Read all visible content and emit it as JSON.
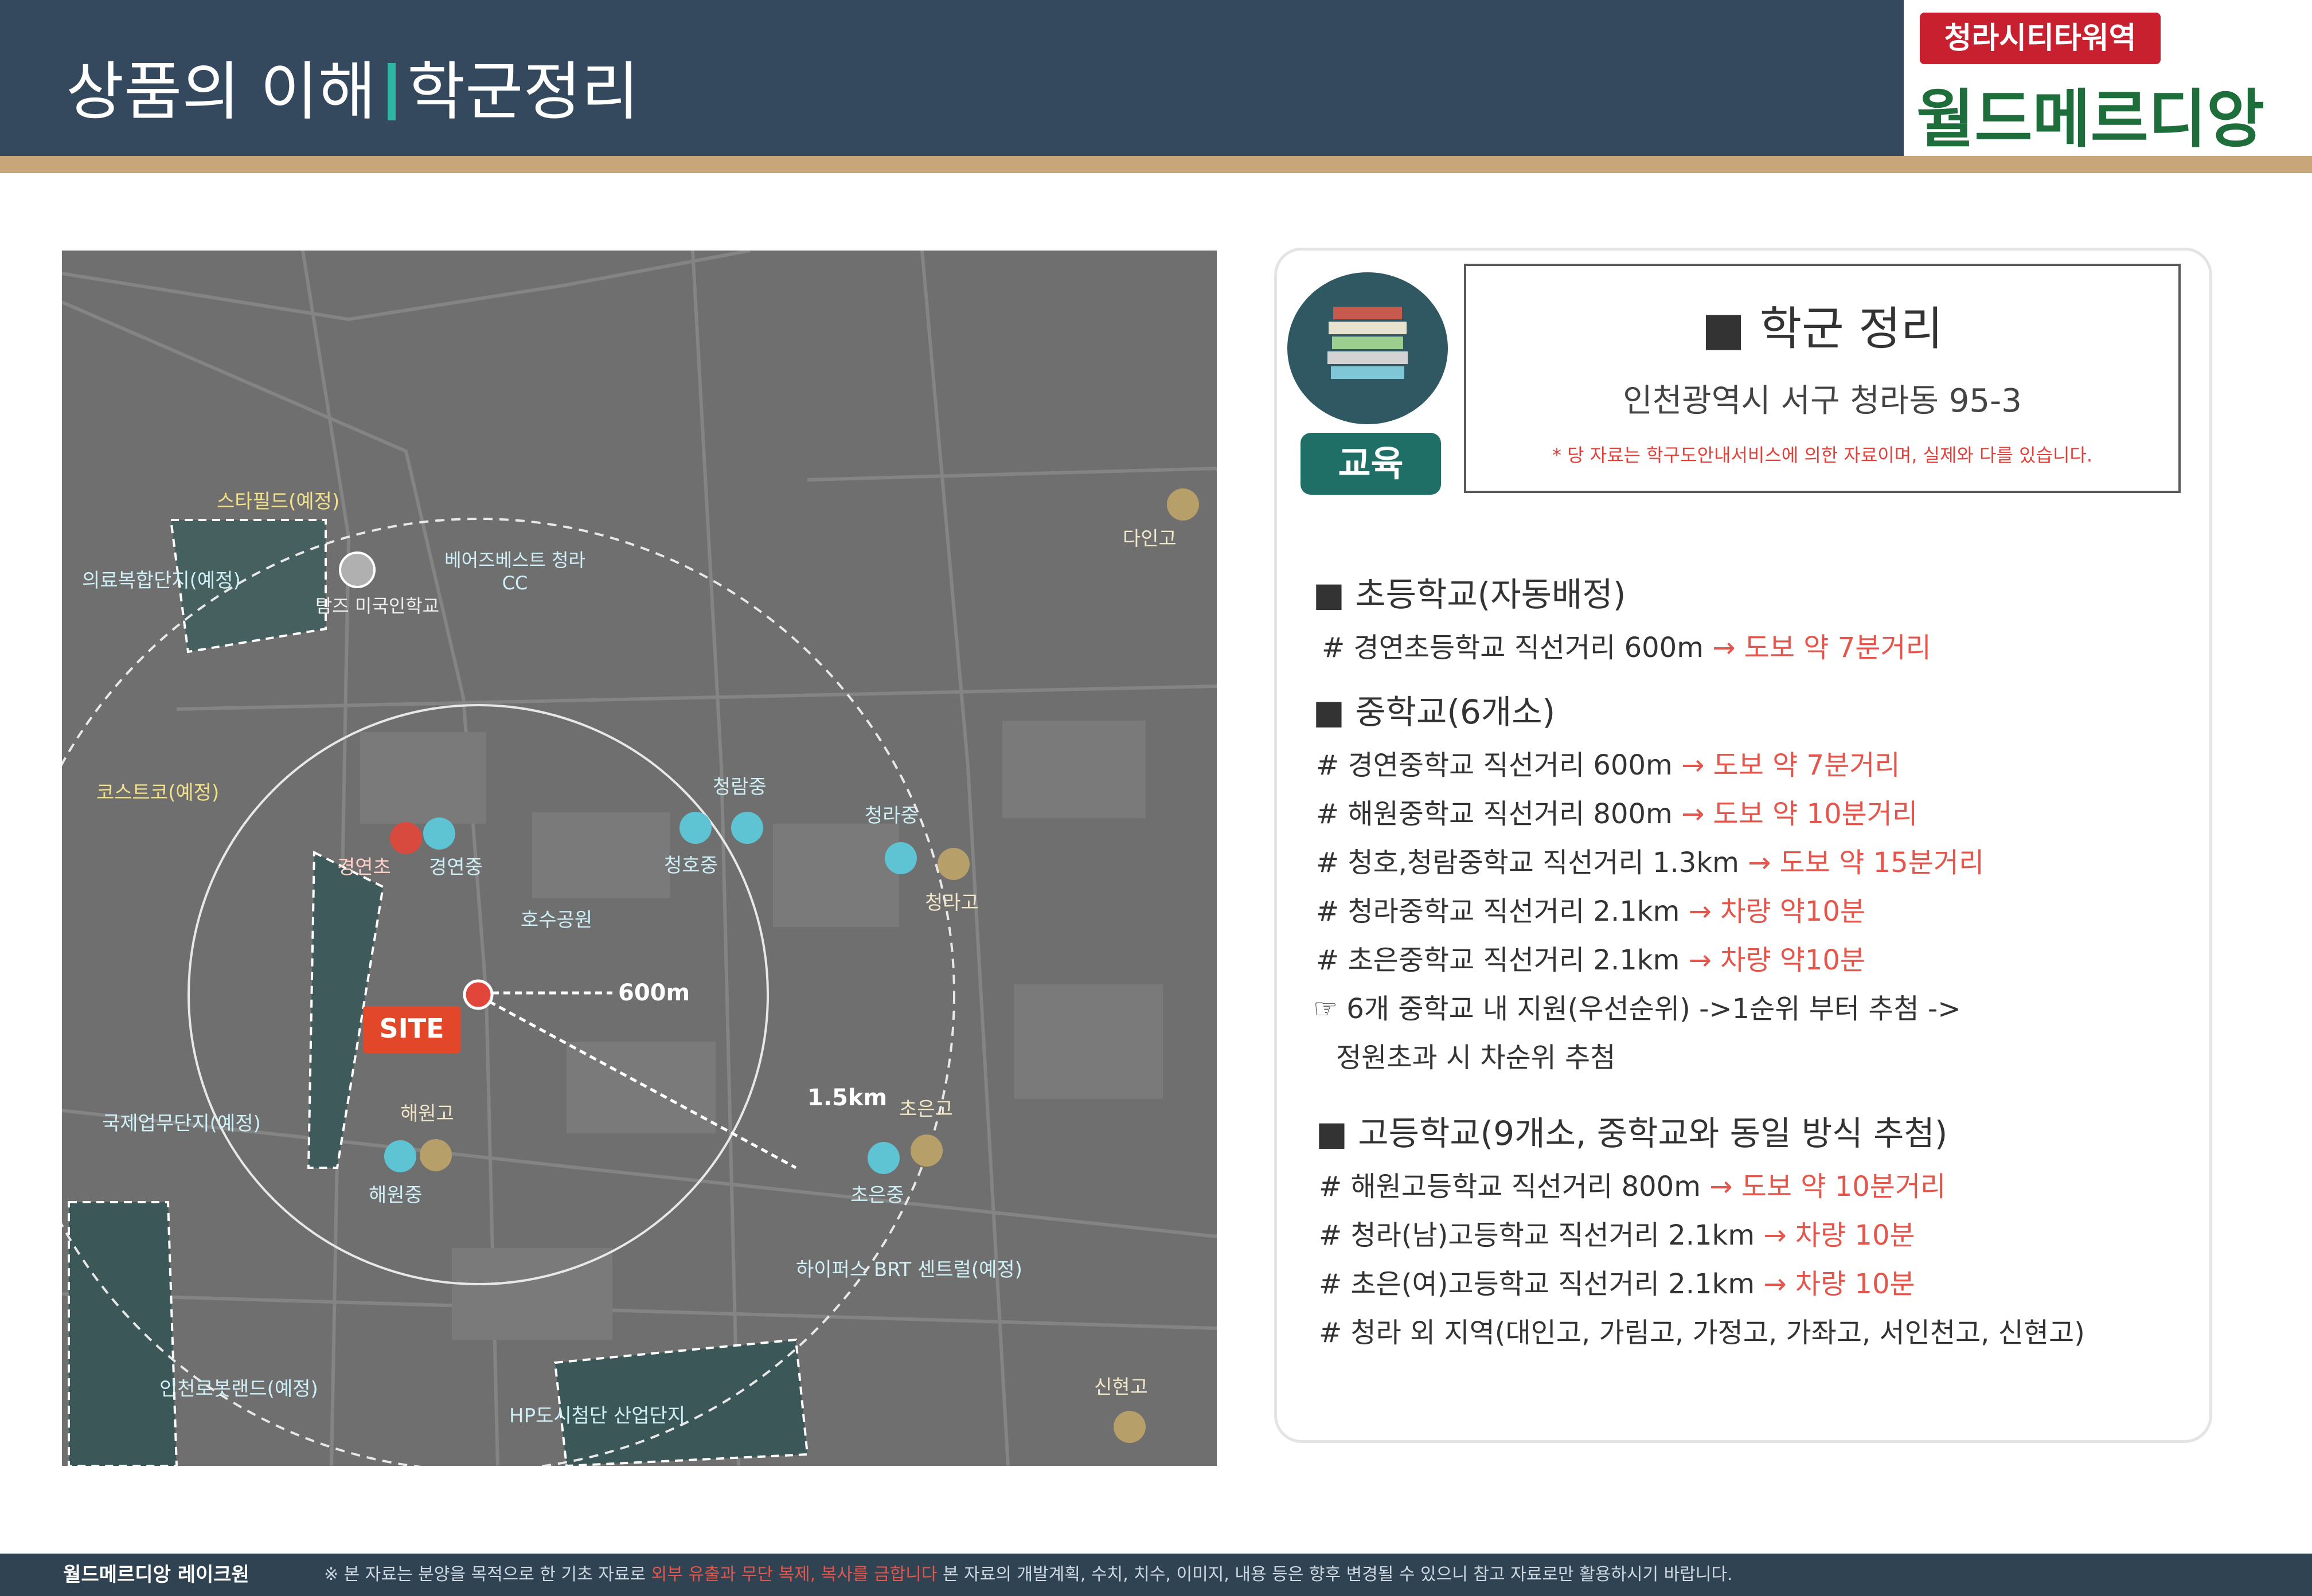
{
  "header": {
    "title_left": "상품의 이해",
    "title_right": "학군정리"
  },
  "logo": {
    "sub": "청라시티타워역",
    "main": "월드메르디앙"
  },
  "map": {
    "site_label": "SITE",
    "dist_600": "600m",
    "dist_1500": "1.5km",
    "places": [
      "스타필드(예정)",
      "의료복합단지(예정)",
      "탐즈 미국인학교",
      "베어즈베스트 청라CC",
      "다인고",
      "코스트코(예정)",
      "청람중",
      "청호중",
      "경연초",
      "경연중",
      "호수공원",
      "청라중",
      "청라고",
      "국제업무단지(예정)",
      "해원고",
      "해원중",
      "초은고",
      "초은중",
      "하이퍼스 BRT 센트럴(예정)",
      "인천로봇랜드(예정)",
      "HP도시첨단 산업단지",
      "신현고"
    ]
  },
  "panel": {
    "edu_label": "교육",
    "title": "■ 학군 정리",
    "address": "인천광역시 서구 청라동 95-3",
    "note": "* 당 자료는 학구도안내서비스에 의한 자료이며, 실제와 다를 있습니다.",
    "sec_elem": "■ 초등학교(자동배정)",
    "elem": [
      {
        "t": "# 경연초등학교 직선거리 600m",
        "r": "→ 도보 약 7분거리"
      }
    ],
    "sec_mid": "■ 중학교(6개소)",
    "mid": [
      {
        "t": "# 경연중학교 직선거리 600m",
        "r": "→ 도보 약 7분거리"
      },
      {
        "t": "# 해원중학교 직선거리 800m",
        "r": "→ 도보 약 10분거리"
      },
      {
        "t": "# 청호,청람중학교 직선거리 1.3km",
        "r": "→ 도보 약 15분거리"
      },
      {
        "t": "# 청라중학교 직선거리 2.1km",
        "r": "→ 차량 약10분"
      },
      {
        "t": "# 초은중학교 직선거리 2.1km",
        "r": "→ 차량 약10분"
      }
    ],
    "mid_note1": "☞ 6개 중학교 내 지원(우선순위) ->1순위 부터 추첨 ->",
    "mid_note2": "정원초과 시 차순위 추첨",
    "sec_high": "■ 고등학교(9개소, 중학교와 동일 방식 추첨)",
    "high": [
      {
        "t": "# 해원고등학교 직선거리 800m",
        "r": "→ 도보 약 10분거리"
      },
      {
        "t": "# 청라(남)고등학교 직선거리 2.1km",
        "r": "→ 차량 10분"
      },
      {
        "t": "# 초은(여)고등학교 직선거리 2.1km",
        "r": "→ 차량 10분"
      },
      {
        "t": "# 청라 외 지역(대인고, 가림고, 가정고, 가좌고, 서인천고, 신현고)",
        "r": ""
      }
    ]
  },
  "footer": {
    "left": "월드메르디앙 레이크원",
    "note_a": "※ 본 자료는 분양을 목적으로 한 기초 자료로",
    "note_red": "외부 유출과 무단 복제, 복사를 금합니다",
    "note_b": "본 자료의 개발계획, 수치, 치수, 이미지, 내용 등은 향후 변경될 수 있으니 참고 자료로만 활용하시기 바랍니다."
  }
}
